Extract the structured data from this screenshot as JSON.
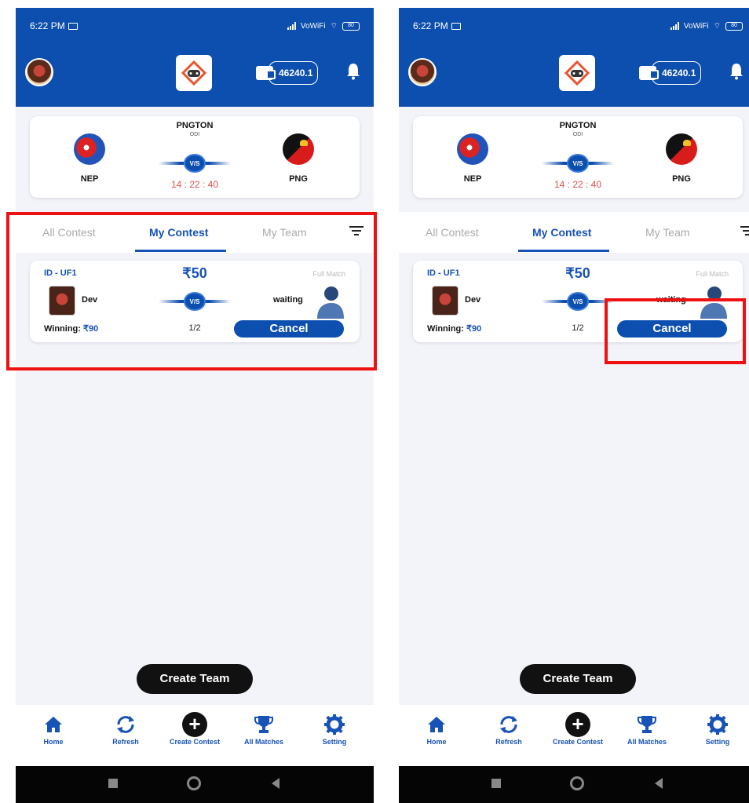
{
  "status_bar": {
    "time": "6:22 PM",
    "network": "VoWiFi",
    "battery": "80"
  },
  "header": {
    "wallet_amount": "46240.1"
  },
  "match": {
    "title": "PNGTON",
    "format": "ODI",
    "team_left": "NEP",
    "team_right": "PNG",
    "vs": "V/S",
    "countdown": "14 : 22 : 40"
  },
  "tabs": {
    "all": "All Contest",
    "my": "My Contest",
    "team": "My Team"
  },
  "contest": {
    "id": "ID - UF1",
    "fee": "₹50",
    "type": "Full Match",
    "player": "Dev",
    "opponent": "waiting",
    "vs": "V/S",
    "winning_label": "Winning: ",
    "winning_amount": "₹90",
    "slots": "1/2",
    "cancel_label": "Cancel"
  },
  "create_team_label": "Create Team",
  "nav": {
    "home": "Home",
    "refresh": "Refresh",
    "create": "Create Contest",
    "matches": "All Matches",
    "setting": "Setting"
  },
  "colors": {
    "primary": "#0d4fae",
    "accent_blue": "#1752b6",
    "highlight": "#ee1111",
    "countdown": "#e05050"
  }
}
